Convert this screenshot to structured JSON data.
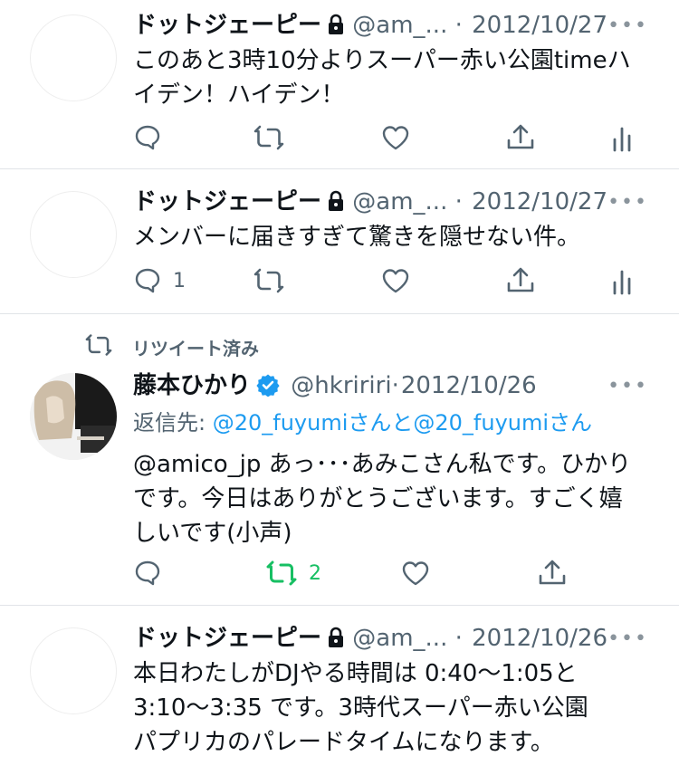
{
  "tweets": [
    {
      "name": "ドットジェーピー",
      "handle": "@am_...",
      "dot": "·",
      "date": "2012/10/27",
      "text": "このあと3時10分よりスーパー赤い公園timeハイデン！ハイデン！",
      "reply_count": "",
      "more": "•••"
    },
    {
      "name": "ドットジェーピー",
      "handle": "@am_...",
      "dot": "·",
      "date": "2012/10/27",
      "text": "メンバーに届きすぎて驚きを隠せない件。",
      "reply_count": "1",
      "more": "•••"
    },
    {
      "retweeted_label": "リツイート済み",
      "name": "藤本ひかり",
      "handle": "@hkririri",
      "dot": "·",
      "date": "2012/10/26",
      "reply_prefix": "返信先: ",
      "reply_targets": "@20_fuyumiさんと@20_fuyumiさん",
      "mention": "@amico_jp",
      "text": " あっ･･･あみこさん私です。ひかりです。今日はありがとうございます。すごく嬉しいです(小声)",
      "retweet_count": "2",
      "more": "•••"
    },
    {
      "name": "ドットジェーピー",
      "handle": "@am_...",
      "dot": "·",
      "date": "2012/10/26",
      "text": "本日わたしがDJやる時間は 0:40〜1:05と3:10〜3:35 です。3時代スーパー赤い公園パプリカのパレードタイムになります。",
      "more": "•••"
    }
  ],
  "icons": {
    "reply": "reply-icon",
    "retweet": "retweet-icon",
    "like": "heart-icon",
    "share": "share-icon",
    "analytics": "analytics-icon",
    "lock": "lock-icon",
    "verified": "verified-badge-icon",
    "more": "more-icon"
  },
  "colors": {
    "text": "#0f1419",
    "muted": "#536471",
    "link": "#1d9bf0",
    "retweet_active": "#17bf63",
    "verified": "#1d9bf0",
    "separator": "#e1e4e8"
  }
}
